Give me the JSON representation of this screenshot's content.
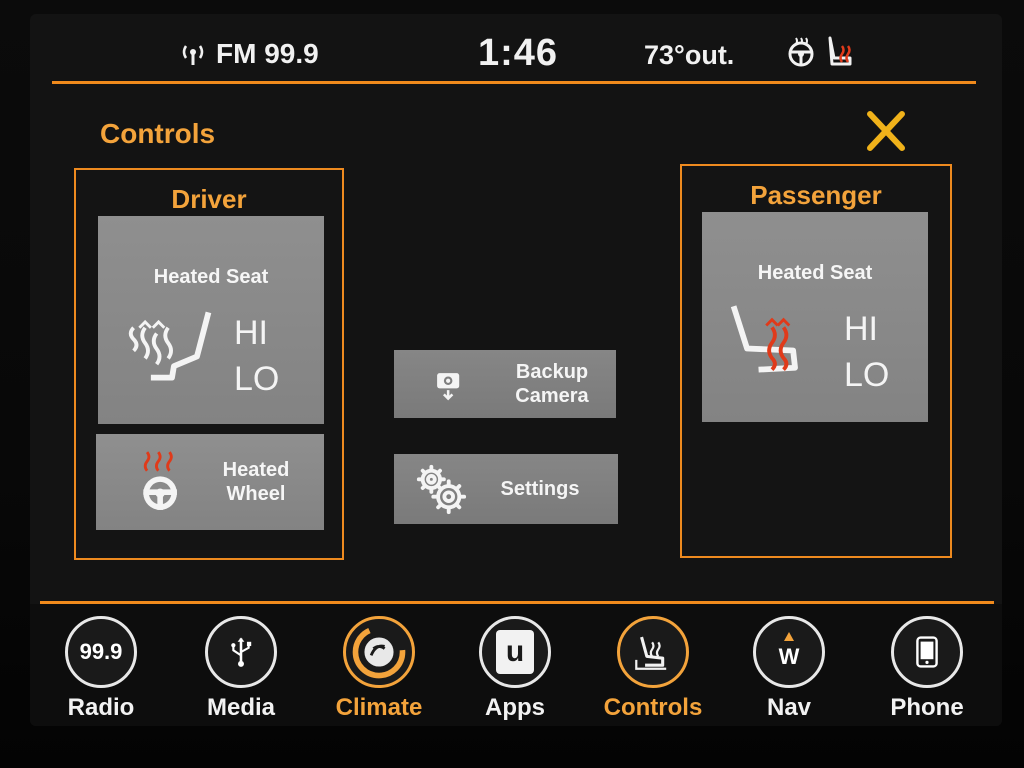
{
  "status": {
    "radio": "FM 99.9",
    "time": "1:46",
    "outside_temp": "73°out."
  },
  "controls": {
    "title": "Controls",
    "driver": {
      "title": "Driver",
      "heated_seat_label": "Heated Seat",
      "hi": "HI",
      "lo": "LO",
      "heated_wheel_line1": "Heated",
      "heated_wheel_line2": "Wheel"
    },
    "passenger": {
      "title": "Passenger",
      "heated_seat_label": "Heated Seat",
      "hi": "HI",
      "lo": "LO"
    },
    "backup_camera_line1": "Backup",
    "backup_camera_line2": "Camera",
    "settings": "Settings"
  },
  "nav": {
    "items": [
      {
        "label": "Radio",
        "icon_text": "99.9"
      },
      {
        "label": "Media"
      },
      {
        "label": "Climate"
      },
      {
        "label": "Apps",
        "icon_text": "u"
      },
      {
        "label": "Controls"
      },
      {
        "label": "Nav",
        "icon_text": "W"
      },
      {
        "label": "Phone"
      }
    ],
    "active": "Controls"
  },
  "colors": {
    "accent": "#f08a1c",
    "heat": "#e03a1a",
    "tile": "#8a8a8a"
  }
}
